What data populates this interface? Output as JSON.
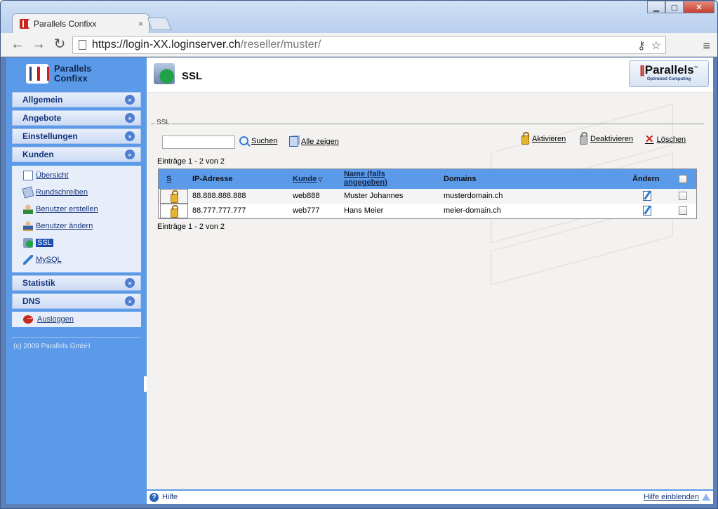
{
  "browser": {
    "tab_title": "Parallels Confixx",
    "tab_close": "×",
    "url_host": "https://login-XX.loginserver.ch",
    "url_path": "/reseller/muster/",
    "back": "←",
    "forward": "→",
    "reload": "↻",
    "key_icon": "⚷",
    "star_icon": "☆",
    "menu_icon": "≡",
    "win_min": "▁",
    "win_max": "▢",
    "win_close": "✕"
  },
  "sidebar": {
    "logo_line1": "Parallels",
    "logo_line2": "Confixx",
    "groups": [
      {
        "label": "Allgemein",
        "state": "collapsed",
        "chevron": "»"
      },
      {
        "label": "Angebote",
        "state": "collapsed",
        "chevron": "»"
      },
      {
        "label": "Einstellungen",
        "state": "collapsed",
        "chevron": "»"
      },
      {
        "label": "Kunden",
        "state": "expanded",
        "chevron": "«"
      },
      {
        "label": "Statistik",
        "state": "collapsed",
        "chevron": "»"
      },
      {
        "label": "DNS",
        "state": "collapsed",
        "chevron": "»"
      }
    ],
    "kunden_items": [
      {
        "label": "Übersicht",
        "icon": "document-icon"
      },
      {
        "label": "Rundschreiben",
        "icon": "mail-icon"
      },
      {
        "label": "Benutzer erstellen",
        "icon": "user-add-icon"
      },
      {
        "label": "Benutzer ändern",
        "icon": "user-edit-icon"
      },
      {
        "label": "SSL",
        "icon": "ssl-icon",
        "active": true
      },
      {
        "label": "MySQL",
        "icon": "mysql-icon"
      }
    ],
    "logout_label": "Ausloggen",
    "copyright": "(c) 2009 Parallels GmbH"
  },
  "header": {
    "title": "SSL",
    "brand_name": "Parallels",
    "brand_tagline": "Optimized Computing",
    "brand_tm": "™"
  },
  "ssl": {
    "legend": "SSL",
    "search_value": "",
    "search_label": "Suchen",
    "show_all_label": "Alle zeigen",
    "activate_label": "Aktivieren",
    "deactivate_label": "Deaktivieren",
    "delete_label": "Löschen",
    "delete_icon": "✕",
    "entries_top": "Einträge 1 - 2 von 2",
    "entries_bottom": "Einträge 1 - 2 von 2",
    "columns": {
      "status": "S",
      "ip": "IP-Adresse",
      "kunde": "Kunde",
      "kunde_sort": "▽",
      "name_line1": "Name (falls",
      "name_line2": "angegeben)",
      "domains": "Domains",
      "edit": "Ändern"
    },
    "rows": [
      {
        "ip": "88.888.888.888",
        "kunde": "web888",
        "name": "Muster Johannes",
        "domain": "musterdomain.ch"
      },
      {
        "ip": "88.777.777.777",
        "kunde": "web777",
        "name": "Hans Meier",
        "domain": "meier-domain.ch"
      }
    ]
  },
  "footer": {
    "help_icon": "?",
    "help_label": "Hilfe",
    "help_show": "Hilfe einblenden"
  },
  "colors": {
    "sidebar_bg": "#5b9ae8",
    "table_header": "#5b9ae8",
    "link": "#15347a"
  }
}
